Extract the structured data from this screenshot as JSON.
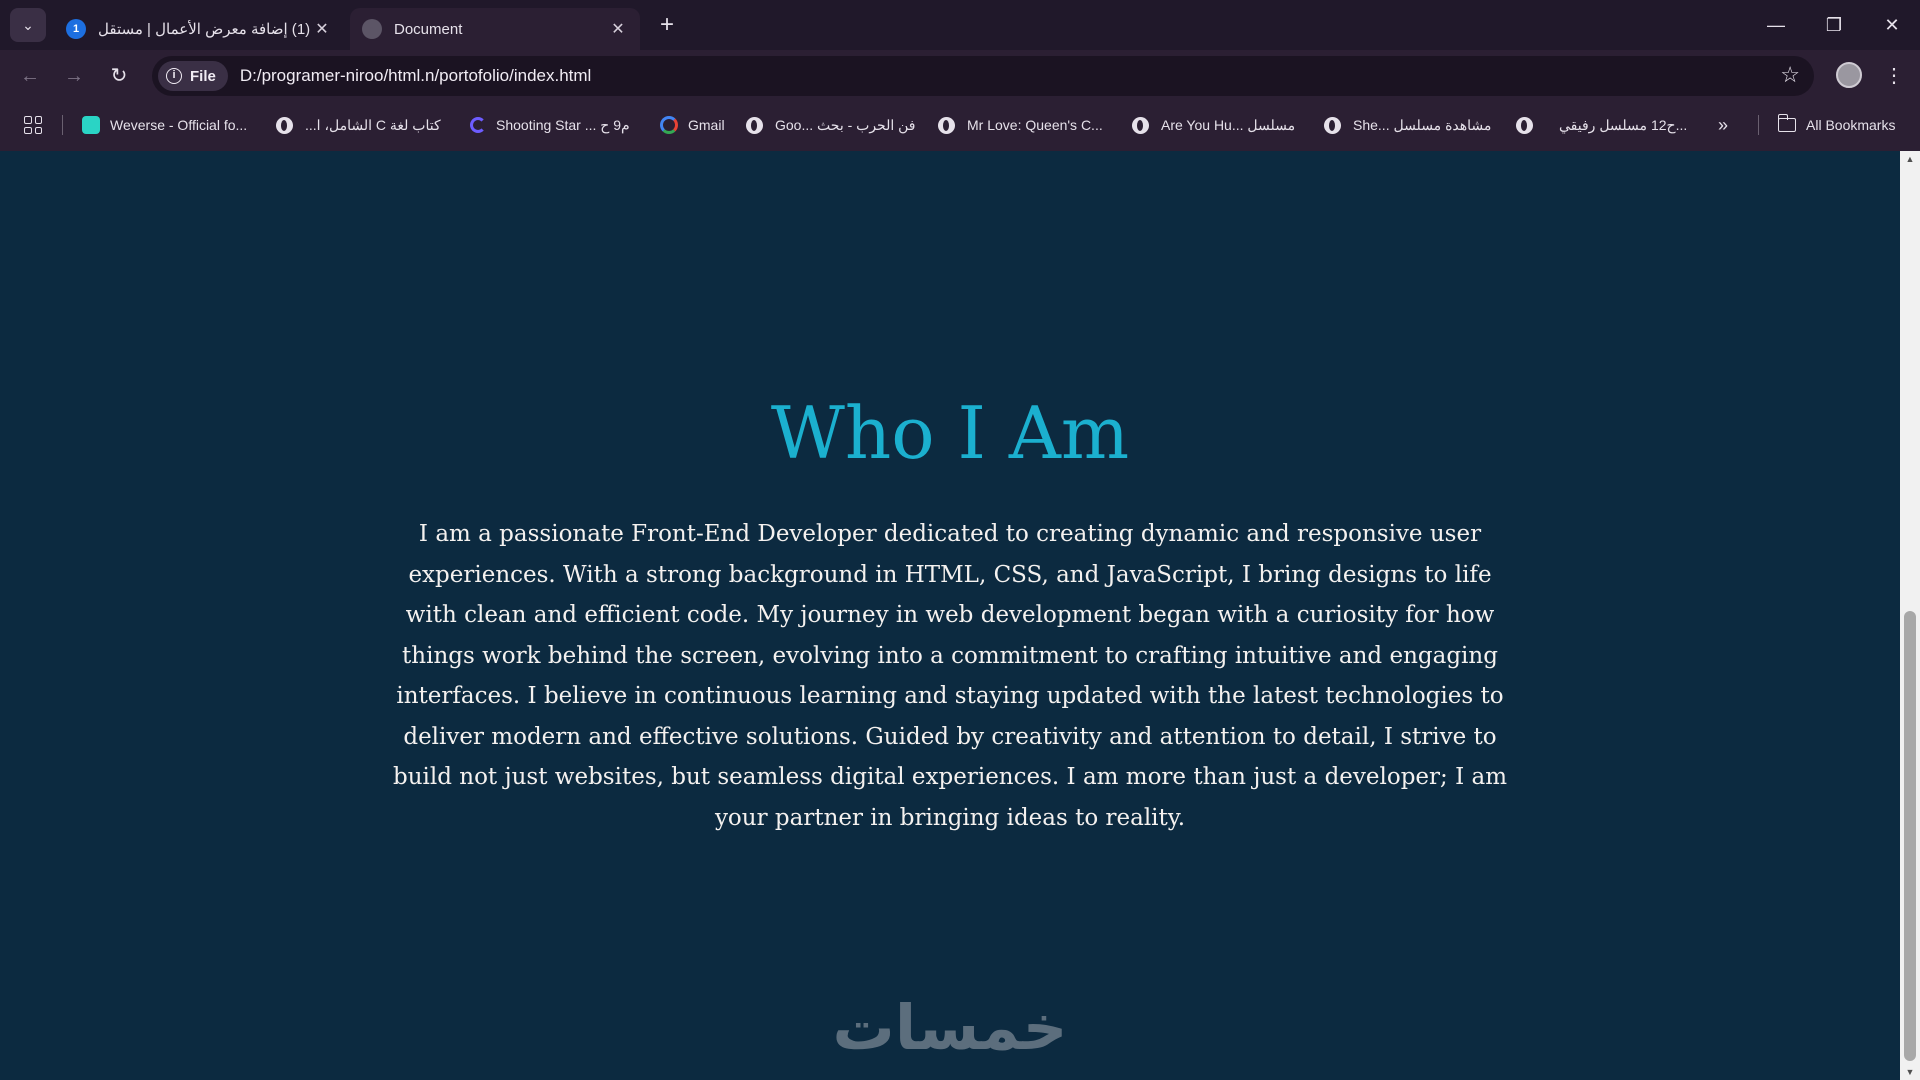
{
  "browser": {
    "tabs": [
      {
        "title": "(1) إضافة معرض الأعمال | مستقل",
        "favicon_badge": "1",
        "active": false
      },
      {
        "title": "Document",
        "active": true
      }
    ],
    "window_controls": {
      "minimize": "—",
      "restore": "❐",
      "close": "✕"
    },
    "nav": {
      "back": "←",
      "forward": "→",
      "reload": "↻"
    },
    "omnibox": {
      "chip_label": "File",
      "url": "D:/programer-niroo/html.n/portofolio/index.html"
    },
    "bookmarks": [
      {
        "label": "Weverse - Official fo...",
        "icon": "weverse-icon"
      },
      {
        "label": "كتاب لغة C الشامل، ا...",
        "icon": "globe-icon"
      },
      {
        "label": "Shooting Star ... م9 ح",
        "icon": "c-icon"
      },
      {
        "label": "Gmail",
        "icon": "google-icon"
      },
      {
        "label": "Goo... فن الحرب - بحث",
        "icon": "globe-icon"
      },
      {
        "label": "Mr Love: Queen's C...",
        "icon": "globe-icon"
      },
      {
        "label": "Are You Hu... مسلسل",
        "icon": "globe-icon"
      },
      {
        "label": "She... مشاهدة مسلسل",
        "icon": "globe-icon"
      },
      {
        "label": "ح12 مسلسل رفيقي...",
        "icon": "globe-icon"
      }
    ],
    "bookmarks_more": "»",
    "all_bookmarks": "All Bookmarks"
  },
  "page": {
    "heading": "Who I Am",
    "about": "I am a passionate Front-End Developer dedicated to creating dynamic and responsive user experiences. With a strong background in HTML, CSS, and JavaScript, I bring designs to life with clean and efficient code. My journey in web development began with a curiosity for how things work behind the screen, evolving into a commitment to crafting intuitive and engaging interfaces. I believe in continuous learning and staying updated with the latest technologies to deliver modern and effective solutions. Guided by creativity and attention to detail, I strive to build not just websites, but seamless digital experiences. I am more than just a developer; I am your partner in bringing ideas to reality.",
    "watermark": "خمسات"
  },
  "colors": {
    "page_bg": "#0c2a40",
    "heading": "#1bb0cf",
    "body_text": "#f4f1ef",
    "chrome_bg": "#2b1f33"
  }
}
